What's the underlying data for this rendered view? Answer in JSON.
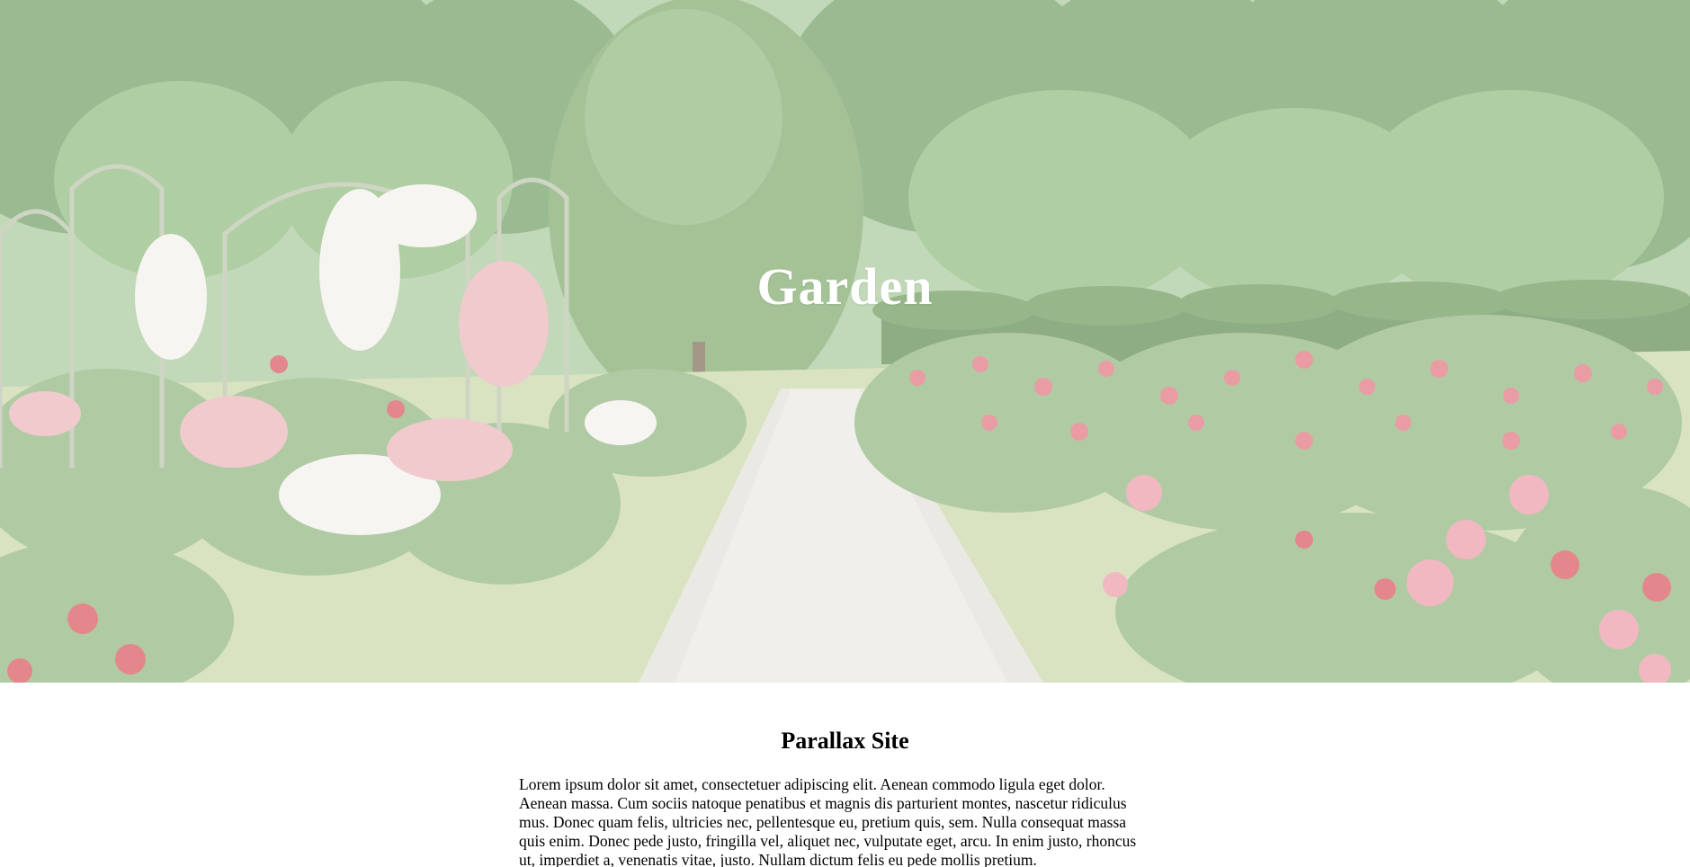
{
  "hero": {
    "title": "Garden",
    "image_alt": "Rose garden with a paved path, flower arches and trees"
  },
  "section": {
    "title": "Parallax Site",
    "body": "Lorem ipsum dolor sit amet, consectetuer adipiscing elit. Aenean commodo ligula eget dolor. Aenean massa. Cum sociis natoque penatibus et magnis dis parturient montes, nascetur ridiculus mus. Donec quam felis, ultricies nec, pellentesque eu, pretium quis, sem. Nulla consequat massa quis enim. Donec pede justo, fringilla vel, aliquet nec, vulputate eget, arcu. In enim justo, rhoncus ut, imperdiet a, venenatis vitae, justo. Nullam dictum felis eu pede mollis pretium."
  },
  "colors": {
    "title_on_image": "#ffffff",
    "body_text": "#000000",
    "page_background": "#ffffff"
  }
}
